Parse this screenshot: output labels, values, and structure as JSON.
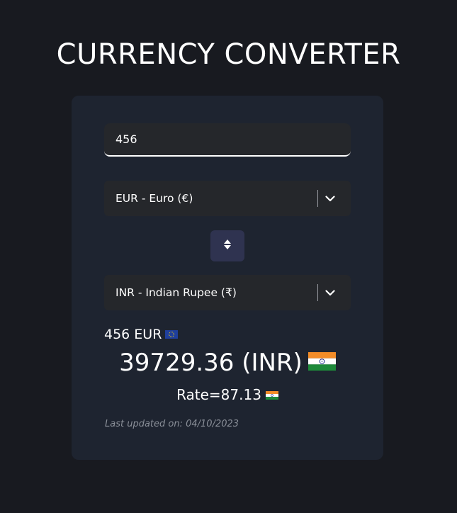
{
  "header": {
    "title": "CURRENCY CONVERTER"
  },
  "converter": {
    "amount_value": "456",
    "from_currency": "EUR - Euro (€)",
    "to_currency": "INR - Indian Rupee (₹)",
    "swap_icon": "swap-vertical-icon"
  },
  "result": {
    "from_text": "456 EUR",
    "from_flag": "eu-flag-icon",
    "converted_text": "39729.36 (INR)",
    "to_flag": "india-flag-icon",
    "rate_text": "Rate=87.13",
    "last_updated": "Last updated on: 04/10/2023"
  },
  "colors": {
    "background": "#181a20",
    "card": "#1e2430",
    "field": "#25272b",
    "swap_button": "#2f3350",
    "muted_text": "#8a8f98"
  }
}
